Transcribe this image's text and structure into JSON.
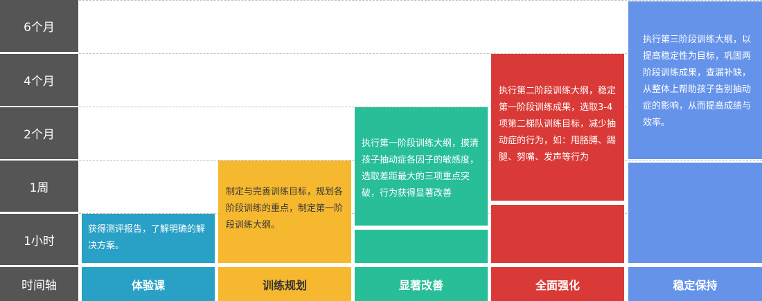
{
  "axis": {
    "labels": [
      "6个月",
      "4个月",
      "2个月",
      "1周",
      "1小时",
      "时间轴"
    ]
  },
  "stages": [
    {
      "name": "体验课",
      "color": "#29a0c6",
      "desc": "获得测评报告，了解明确的解决方案。"
    },
    {
      "name": "训练规划",
      "color": "#f6b82e",
      "desc": "制定与完善训练目标，规划各阶段训练的重点，制定第一阶段训练大纲。"
    },
    {
      "name": "显著改善",
      "color": "#27be98",
      "desc": "执行第一阶段训练大纲，摸清孩子抽动症各因子的敏感度，选取差距最大的三项重点突破，行为获得显著改善"
    },
    {
      "name": "全面强化",
      "color": "#d93a37",
      "desc": "执行第二阶段训练大纲，稳定第一阶段训练成果，选取3-4项第二梯队训练目标，减少抽动症的行为，如：甩胳膊、踢腿、努嘴、发声等行为"
    },
    {
      "name": "稳定保持",
      "color": "#6593ea",
      "desc": "执行第三阶段训练大纲，以提高稳定性为目标，巩固两阶段训练成果，查漏补缺，从整体上帮助孩子告别抽动症的影响，从而提高成绩与效率。"
    }
  ]
}
